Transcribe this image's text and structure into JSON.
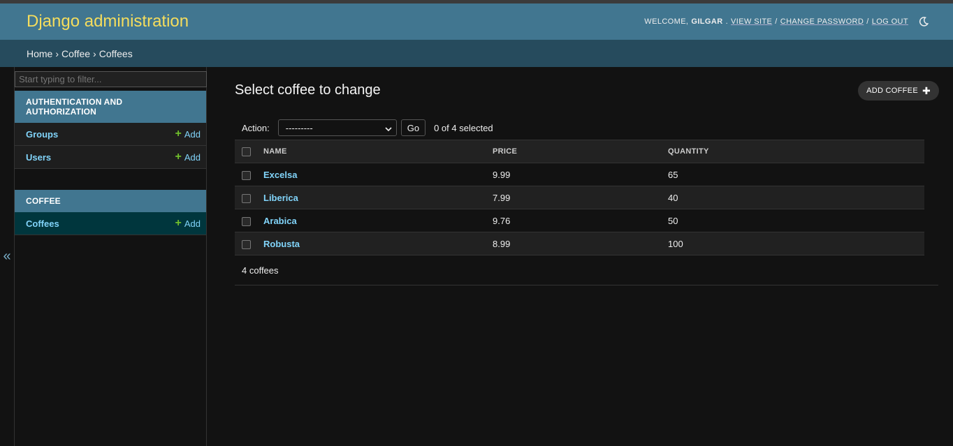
{
  "header": {
    "branding": "Django administration",
    "welcome": "WELCOME,",
    "username": "GILGAR",
    "view_site": "VIEW SITE",
    "change_password": "CHANGE PASSWORD",
    "log_out": "LOG OUT",
    "separator": "/"
  },
  "breadcrumbs": {
    "items": [
      "Home",
      "Coffee",
      "Coffees"
    ],
    "separator": "›"
  },
  "sidebar": {
    "filter_placeholder": "Start typing to filter...",
    "toggle": "«",
    "modules": [
      {
        "caption": "AUTHENTICATION AND AUTHORIZATION",
        "rows": [
          {
            "label": "Groups",
            "add": "Add"
          },
          {
            "label": "Users",
            "add": "Add"
          }
        ]
      },
      {
        "caption": "COFFEE",
        "rows": [
          {
            "label": "Coffees",
            "add": "Add"
          }
        ]
      }
    ]
  },
  "content": {
    "title": "Select coffee to change",
    "add_button": "ADD COFFEE",
    "action_label": "Action:",
    "action_selected": "---------",
    "go_label": "Go",
    "selection_count": "0 of 4 selected",
    "columns": [
      "NAME",
      "PRICE",
      "QUANTITY"
    ],
    "rows": [
      {
        "name": "Excelsa",
        "price": "9.99",
        "quantity": "65"
      },
      {
        "name": "Liberica",
        "price": "7.99",
        "quantity": "40"
      },
      {
        "name": "Arabica",
        "price": "9.76",
        "quantity": "50"
      },
      {
        "name": "Robusta",
        "price": "8.99",
        "quantity": "100"
      }
    ],
    "paginator": "4 coffees"
  },
  "colors": {
    "header_bg": "#417690",
    "breadcrumbs_bg": "#264b5d",
    "branding": "#f5dd5d",
    "link": "#81d4fa",
    "add_plus": "#70bf2b",
    "current_row": "#00363d"
  }
}
